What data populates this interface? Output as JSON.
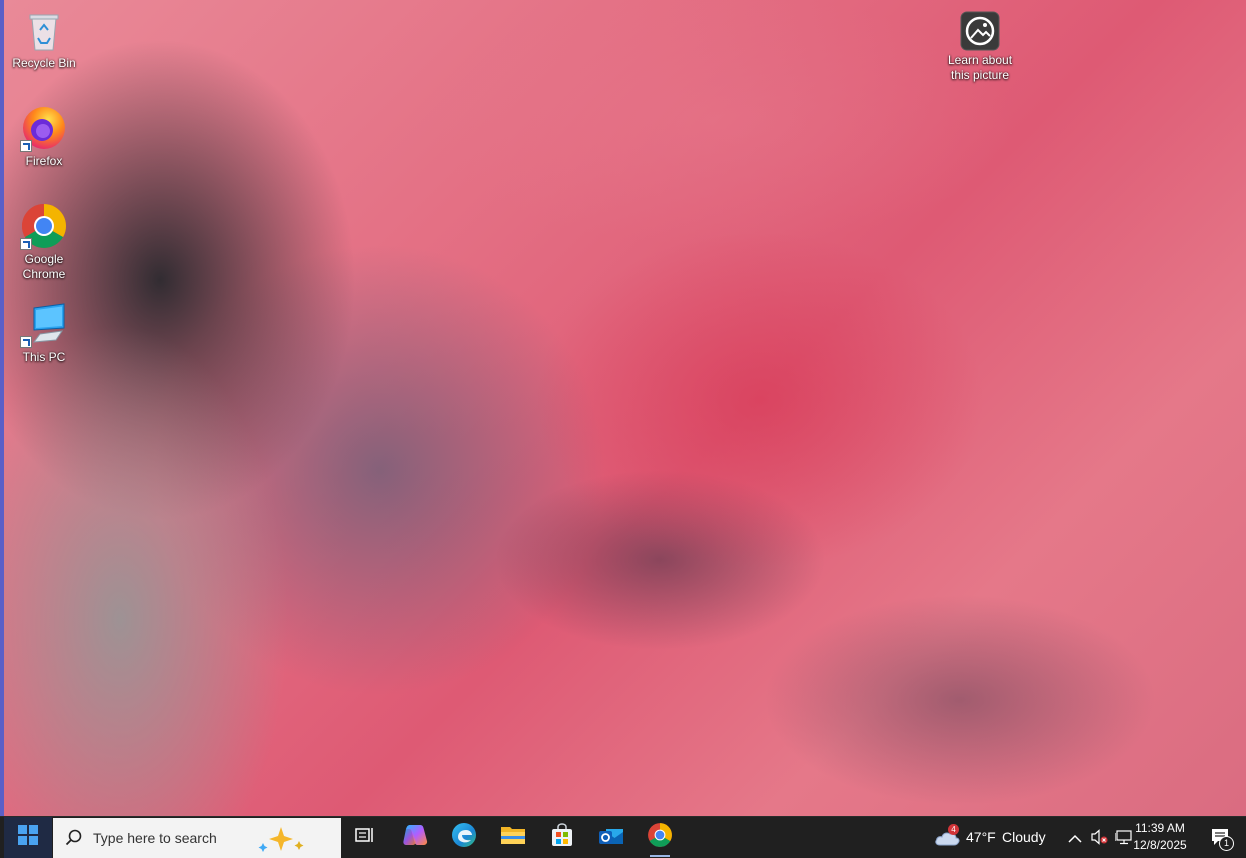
{
  "desktop": {
    "icons": [
      {
        "label": "Recycle Bin"
      },
      {
        "label": "Firefox"
      },
      {
        "label": "Google\nChrome"
      },
      {
        "label": "This PC"
      }
    ],
    "learn_icon": {
      "label": "Learn about\nthis picture"
    }
  },
  "taskbar": {
    "search_placeholder": "Type here to search",
    "apps": [
      "task-view",
      "copilot",
      "edge",
      "file-explorer",
      "microsoft-store",
      "outlook",
      "chrome"
    ],
    "weather": {
      "temp": "47°F",
      "condition": "Cloudy",
      "badge": "4"
    },
    "clock": {
      "time": "11:39 AM",
      "date": "12/8/2025"
    },
    "notifications_badge": "1"
  }
}
